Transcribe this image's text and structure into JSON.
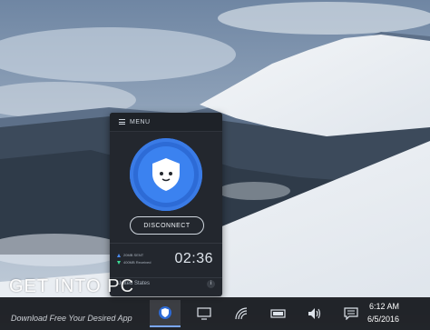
{
  "vpn": {
    "menu_label": "MENU",
    "disconnect_label": "DISCONNECT",
    "sent_label": "20MB SENT",
    "received_label": "400MB Received",
    "timer": "02:36",
    "location": "United States",
    "info_glyph": "i",
    "accent_color": "#2d6bd6"
  },
  "watermark": {
    "title": "GET INTO PC",
    "subtitle": "Download Free Your Desired App"
  },
  "taskbar": {
    "icons": [
      "vpn-shield-icon",
      "desktop-icon",
      "wifi-icon",
      "battery-icon",
      "volume-icon",
      "action-center-icon"
    ],
    "time": "6:12 AM",
    "date": "6/5/2016"
  }
}
